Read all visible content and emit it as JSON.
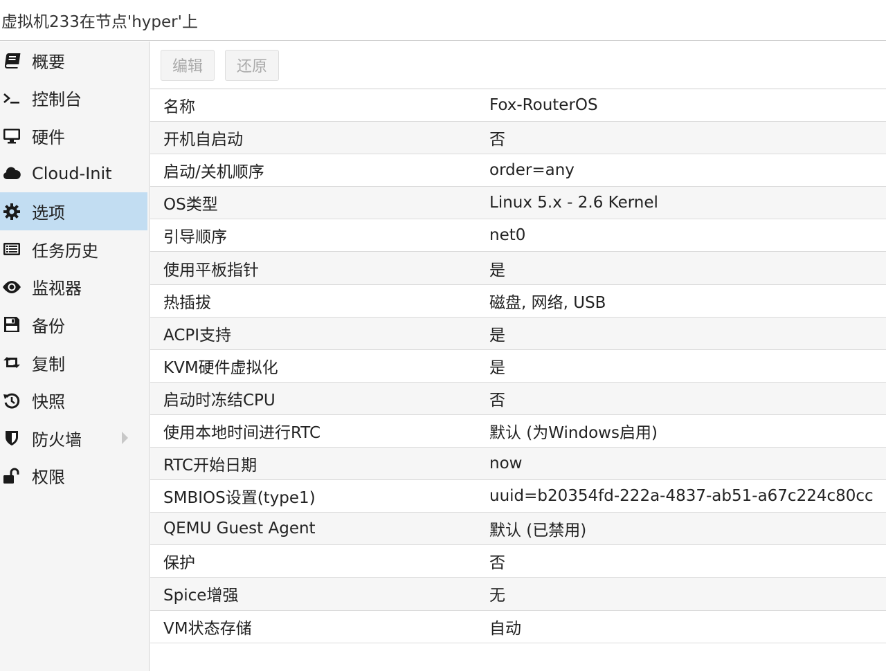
{
  "window": {
    "title": "虚拟机233在节点'hyper'上"
  },
  "sidebar": {
    "items": [
      {
        "label": "概要",
        "icon": "book-icon"
      },
      {
        "label": "控制台",
        "icon": "terminal-icon"
      },
      {
        "label": "硬件",
        "icon": "monitor-icon"
      },
      {
        "label": "Cloud-Init",
        "icon": "cloud-icon"
      },
      {
        "label": "选项",
        "icon": "gear-icon",
        "selected": true
      },
      {
        "label": "任务历史",
        "icon": "list-icon"
      },
      {
        "label": "监视器",
        "icon": "eye-icon"
      },
      {
        "label": "备份",
        "icon": "floppy-icon"
      },
      {
        "label": "复制",
        "icon": "retweet-icon"
      },
      {
        "label": "快照",
        "icon": "history-icon"
      },
      {
        "label": "防火墙",
        "icon": "shield-icon",
        "has_submenu": true
      },
      {
        "label": "权限",
        "icon": "unlock-icon"
      }
    ]
  },
  "toolbar": {
    "edit_label": "编辑",
    "revert_label": "还原"
  },
  "options": {
    "rows": [
      {
        "key": "名称",
        "value": "Fox-RouterOS"
      },
      {
        "key": "开机自启动",
        "value": "否"
      },
      {
        "key": "启动/关机顺序",
        "value": "order=any"
      },
      {
        "key": "OS类型",
        "value": "Linux 5.x - 2.6 Kernel"
      },
      {
        "key": "引导顺序",
        "value": "net0"
      },
      {
        "key": "使用平板指针",
        "value": "是"
      },
      {
        "key": "热插拔",
        "value": "磁盘, 网络, USB"
      },
      {
        "key": "ACPI支持",
        "value": "是"
      },
      {
        "key": "KVM硬件虚拟化",
        "value": "是"
      },
      {
        "key": "启动时冻结CPU",
        "value": "否"
      },
      {
        "key": "使用本地时间进行RTC",
        "value": "默认 (为Windows启用)"
      },
      {
        "key": "RTC开始日期",
        "value": "now"
      },
      {
        "key": "SMBIOS设置(type1)",
        "value": "uuid=b20354fd-222a-4837-ab51-a67c224c80cc"
      },
      {
        "key": "QEMU Guest Agent",
        "value": "默认 (已禁用)"
      },
      {
        "key": "保护",
        "value": "否"
      },
      {
        "key": "Spice增强",
        "value": "无"
      },
      {
        "key": "VM状态存储",
        "value": "自动"
      }
    ]
  },
  "colors": {
    "selected_bg": "#c2ddf2",
    "icon": "#1a1a1a"
  }
}
